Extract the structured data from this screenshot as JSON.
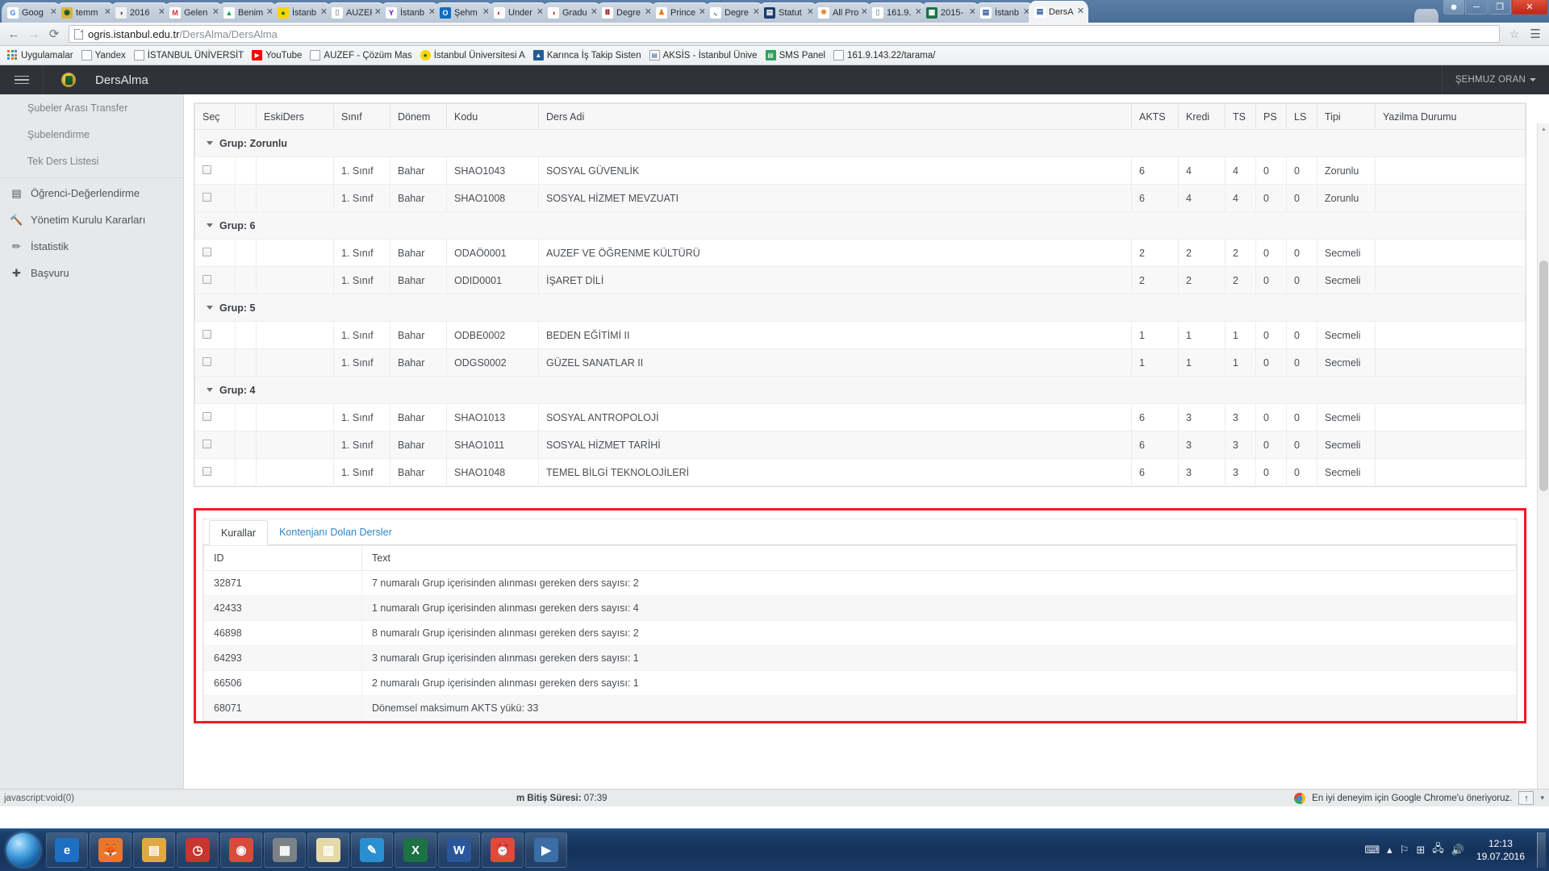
{
  "browser": {
    "tabs": [
      {
        "label": "Goog",
        "icon": "google-icon",
        "color": "#ffffff",
        "glyph": "G",
        "glyph_color": "#4285f4",
        "active": false
      },
      {
        "label": "temm",
        "icon": "istanbul-university-icon",
        "color": "#d9b63a",
        "glyph": "◉",
        "glyph_color": "#14532d",
        "active": false
      },
      {
        "label": "2016",
        "icon": "generic-circle-icon",
        "color": "#f1f1f1",
        "glyph": "◑",
        "glyph_color": "#444444",
        "active": false
      },
      {
        "label": "Gelen",
        "icon": "gmail-icon",
        "color": "#ffffff",
        "glyph": "M",
        "glyph_color": "#d93025",
        "active": false
      },
      {
        "label": "Benim",
        "icon": "google-drive-icon",
        "color": "#ffffff",
        "glyph": "▲",
        "glyph_color": "#0f9d58",
        "active": false
      },
      {
        "label": "İstanb",
        "icon": "site-icon-green",
        "color": "#ffd400",
        "glyph": "●",
        "glyph_color": "#0b6b2d",
        "active": false
      },
      {
        "label": "AUZEF",
        "icon": "page-icon",
        "color": "#ffffff",
        "glyph": "▯",
        "glyph_color": "#9aa0a6",
        "active": false
      },
      {
        "label": "İstanb",
        "icon": "yahoo-icon",
        "color": "#ffffff",
        "glyph": "Y",
        "glyph_color": "#6001d2",
        "active": false
      },
      {
        "label": "Şehm",
        "icon": "outlook-icon",
        "color": "#0f6cbd",
        "glyph": "O",
        "glyph_color": "#ffffff",
        "active": false
      },
      {
        "label": "Under",
        "icon": "site-icon-red",
        "color": "#ffffff",
        "glyph": "◐",
        "glyph_color": "#c8102e",
        "active": false
      },
      {
        "label": "Gradu",
        "icon": "site-icon-red2",
        "color": "#ffffff",
        "glyph": "◑",
        "glyph_color": "#d01c1f",
        "active": false
      },
      {
        "label": "Degre",
        "icon": "indiana-icon",
        "color": "#ffffff",
        "glyph": "Ⅲ",
        "glyph_color": "#990000",
        "active": false
      },
      {
        "label": "Prince",
        "icon": "princeton-icon",
        "color": "#ffffff",
        "glyph": "♟",
        "glyph_color": "#e77500",
        "active": false
      },
      {
        "label": "Degre",
        "icon": "site-icon-blue",
        "color": "#ffffff",
        "glyph": "◟",
        "glyph_color": "#1f5c99",
        "active": false
      },
      {
        "label": "Statut",
        "icon": "statute-icon",
        "color": "#1b3a6b",
        "glyph": "▤",
        "glyph_color": "#ffffff",
        "active": false
      },
      {
        "label": "All Pro",
        "icon": "sunburst-icon",
        "color": "#ffffff",
        "glyph": "✹",
        "glyph_color": "#e08a2b",
        "active": false
      },
      {
        "label": "161.9.",
        "icon": "page-icon",
        "color": "#ffffff",
        "glyph": "▯",
        "glyph_color": "#9aa0a6",
        "active": false
      },
      {
        "label": "2015-",
        "icon": "excel-sheet-icon",
        "color": "#1e7145",
        "glyph": "▦",
        "glyph_color": "#ffffff",
        "active": false
      },
      {
        "label": "İstanb",
        "icon": "word-doc-icon",
        "color": "#ffffff",
        "glyph": "▤",
        "glyph_color": "#2b579a",
        "active": false
      },
      {
        "label": "DersA",
        "icon": "word-doc-icon",
        "color": "#ffffff",
        "glyph": "▤",
        "glyph_color": "#2b579a",
        "active": true
      }
    ],
    "tab_close_glyph": "✕",
    "nav": {
      "back": "←",
      "forward": "→",
      "reload": "⟳",
      "star": "☆",
      "menu": "☰"
    },
    "url": {
      "host": "ogris.istanbul.edu.tr",
      "path": "/DersAlma/DersAlma"
    },
    "window_controls": {
      "user": "☻",
      "minimize": "─",
      "maximize": "❐",
      "close": "✕"
    },
    "bookmarks": [
      {
        "label": "Uygulamalar",
        "icon": "apps-grid-icon"
      },
      {
        "label": "Yandex",
        "icon": "page-icon"
      },
      {
        "label": "İSTANBUL ÜNİVERSİT",
        "icon": "page-icon"
      },
      {
        "label": "YouTube",
        "icon": "youtube-icon"
      },
      {
        "label": "AUZEF - Çözüm Mas",
        "icon": "page-icon"
      },
      {
        "label": "İstanbul Üniversitesi A",
        "icon": "site-icon-yellow"
      },
      {
        "label": "Karınca İş Takip Sisten",
        "icon": "site-icon-blue"
      },
      {
        "label": "AKSİS - İstanbul Ünive",
        "icon": "word-doc-icon"
      },
      {
        "label": "SMS Panel",
        "icon": "site-icon-green"
      },
      {
        "label": "161.9.143.22/tarama/",
        "icon": "page-icon"
      }
    ]
  },
  "app": {
    "title": "DersAlma",
    "logo_name": "istanbul-university-logo",
    "user": "ŞEHMUZ ORAN"
  },
  "sidebar": {
    "sub_items": [
      {
        "label": "Şubeler Arası Transfer"
      },
      {
        "label": "Şubelendirme"
      },
      {
        "label": "Tek Ders Listesi"
      }
    ],
    "items": [
      {
        "label": "Öğrenci-Değerlendirme",
        "icon": "book-icon",
        "glyph": "▤"
      },
      {
        "label": "Yönetim Kurulu Kararları",
        "icon": "gavel-icon",
        "glyph": "🔨"
      },
      {
        "label": "İstatistik",
        "icon": "pencil-icon",
        "glyph": "✏"
      },
      {
        "label": "Başvuru",
        "icon": "plus-icon",
        "glyph": "✚"
      }
    ]
  },
  "course_table": {
    "columns": [
      "Seç",
      "",
      "EskiDers",
      "Sınıf",
      "Dönem",
      "Kodu",
      "Ders Adi",
      "AKTS",
      "Kredi",
      "TS",
      "PS",
      "LS",
      "Tipi",
      "Yazilma Durumu"
    ],
    "groups": [
      {
        "label": "Grup: Zorunlu",
        "rows": [
          {
            "eskiders": "",
            "sinif": "1. Sınıf",
            "donem": "Bahar",
            "kodu": "SHAO1043",
            "ders_adi": "SOSYAL GÜVENLİK",
            "akts": "6",
            "kredi": "4",
            "ts": "4",
            "ps": "0",
            "ls": "0",
            "tipi": "Zorunlu",
            "yazilma": ""
          },
          {
            "eskiders": "",
            "sinif": "1. Sınıf",
            "donem": "Bahar",
            "kodu": "SHAO1008",
            "ders_adi": "SOSYAL HİZMET MEVZUATI",
            "akts": "6",
            "kredi": "4",
            "ts": "4",
            "ps": "0",
            "ls": "0",
            "tipi": "Zorunlu",
            "yazilma": ""
          }
        ]
      },
      {
        "label": "Grup: 6",
        "rows": [
          {
            "eskiders": "",
            "sinif": "1. Sınıf",
            "donem": "Bahar",
            "kodu": "ODAÖ0001",
            "ders_adi": "AUZEF VE ÖĞRENME KÜLTÜRÜ",
            "akts": "2",
            "kredi": "2",
            "ts": "2",
            "ps": "0",
            "ls": "0",
            "tipi": "Secmeli",
            "yazilma": ""
          },
          {
            "eskiders": "",
            "sinif": "1. Sınıf",
            "donem": "Bahar",
            "kodu": "ODID0001",
            "ders_adi": "İŞARET DİLİ",
            "akts": "2",
            "kredi": "2",
            "ts": "2",
            "ps": "0",
            "ls": "0",
            "tipi": "Secmeli",
            "yazilma": ""
          }
        ]
      },
      {
        "label": "Grup: 5",
        "rows": [
          {
            "eskiders": "",
            "sinif": "1. Sınıf",
            "donem": "Bahar",
            "kodu": "ODBE0002",
            "ders_adi": "BEDEN EĞİTİMİ II",
            "akts": "1",
            "kredi": "1",
            "ts": "1",
            "ps": "0",
            "ls": "0",
            "tipi": "Secmeli",
            "yazilma": ""
          },
          {
            "eskiders": "",
            "sinif": "1. Sınıf",
            "donem": "Bahar",
            "kodu": "ODGS0002",
            "ders_adi": "GÜZEL SANATLAR II",
            "akts": "1",
            "kredi": "1",
            "ts": "1",
            "ps": "0",
            "ls": "0",
            "tipi": "Secmeli",
            "yazilma": ""
          }
        ]
      },
      {
        "label": "Grup: 4",
        "rows": [
          {
            "eskiders": "",
            "sinif": "1. Sınıf",
            "donem": "Bahar",
            "kodu": "SHAO1013",
            "ders_adi": "SOSYAL ANTROPOLOJİ",
            "akts": "6",
            "kredi": "3",
            "ts": "3",
            "ps": "0",
            "ls": "0",
            "tipi": "Secmeli",
            "yazilma": ""
          },
          {
            "eskiders": "",
            "sinif": "1. Sınıf",
            "donem": "Bahar",
            "kodu": "SHAO1011",
            "ders_adi": "SOSYAL HİZMET TARİHİ",
            "akts": "6",
            "kredi": "3",
            "ts": "3",
            "ps": "0",
            "ls": "0",
            "tipi": "Secmeli",
            "yazilma": ""
          },
          {
            "eskiders": "",
            "sinif": "1. Sınıf",
            "donem": "Bahar",
            "kodu": "SHAO1048",
            "ders_adi": "TEMEL BİLGİ TEKNOLOJİLERİ",
            "akts": "6",
            "kredi": "3",
            "ts": "3",
            "ps": "0",
            "ls": "0",
            "tipi": "Secmeli",
            "yazilma": ""
          }
        ]
      }
    ]
  },
  "rules_panel": {
    "highlight_color": "#ee1c24",
    "tabs": [
      {
        "label": "Kurallar",
        "active": true
      },
      {
        "label": "Kontenjanı Dolan Dersler",
        "active": false
      }
    ],
    "columns": [
      "ID",
      "Text"
    ],
    "rows": [
      {
        "id": "32871",
        "text": "7 numaralı Grup içerisinden alınması gereken ders sayısı: 2"
      },
      {
        "id": "42433",
        "text": "1 numaralı Grup içerisinden alınması gereken ders sayısı: 4"
      },
      {
        "id": "46898",
        "text": "8 numaralı Grup içerisinden alınması gereken ders sayısı: 2"
      },
      {
        "id": "64293",
        "text": "3 numaralı Grup içerisinden alınması gereken ders sayısı: 1"
      },
      {
        "id": "66506",
        "text": "2 numaralı Grup içerisinden alınması gereken ders sayısı: 1"
      },
      {
        "id": "68071",
        "text": "Dönemsel maksimum AKTS yükü: 33"
      }
    ]
  },
  "status_bar": {
    "left": "javascript:void(0)",
    "middle_label": "m Bitiş Süresi:",
    "middle_value": "07:39",
    "promo_text": "En iyi deneyim için Google Chrome'u öneriyoruz.",
    "promo_up_glyph": "↑",
    "promo_caret_glyph": "▾"
  },
  "taskbar": {
    "start_name": "start-orb",
    "apps": [
      {
        "name": "internet-explorer",
        "glyph": "e",
        "bg": "#1d6fc4"
      },
      {
        "name": "firefox",
        "glyph": "🦊",
        "bg": "#e8762c"
      },
      {
        "name": "explorer-folder",
        "glyph": "▤",
        "bg": "#e0a844"
      },
      {
        "name": "clock-app",
        "glyph": "◷",
        "bg": "#c9352f"
      },
      {
        "name": "chrome",
        "glyph": "◉",
        "bg": "#d94a3d"
      },
      {
        "name": "calculator",
        "glyph": "▦",
        "bg": "#7d8287"
      },
      {
        "name": "notepad-stack",
        "glyph": "▥",
        "bg": "#e6d9a8"
      },
      {
        "name": "paint-brush",
        "glyph": "✎",
        "bg": "#2a8fd0"
      },
      {
        "name": "excel",
        "glyph": "X",
        "bg": "#1e7145"
      },
      {
        "name": "word",
        "glyph": "W",
        "bg": "#2b579a"
      },
      {
        "name": "alarm",
        "glyph": "⏰",
        "bg": "#e04a3a"
      },
      {
        "name": "media-player",
        "glyph": "▶",
        "bg": "#3a6ea5"
      }
    ],
    "tray": [
      {
        "name": "keyboard-icon",
        "glyph": "⌨"
      },
      {
        "name": "show-hidden-icons",
        "glyph": "▴"
      },
      {
        "name": "action-center-flag-icon",
        "glyph": "⚐"
      },
      {
        "name": "windows-update-icon",
        "glyph": "⊞"
      },
      {
        "name": "network-icon",
        "glyph": "🖧"
      },
      {
        "name": "volume-icon",
        "glyph": "🔊"
      }
    ],
    "clock_time": "12:13",
    "clock_date": "19.07.2016"
  }
}
